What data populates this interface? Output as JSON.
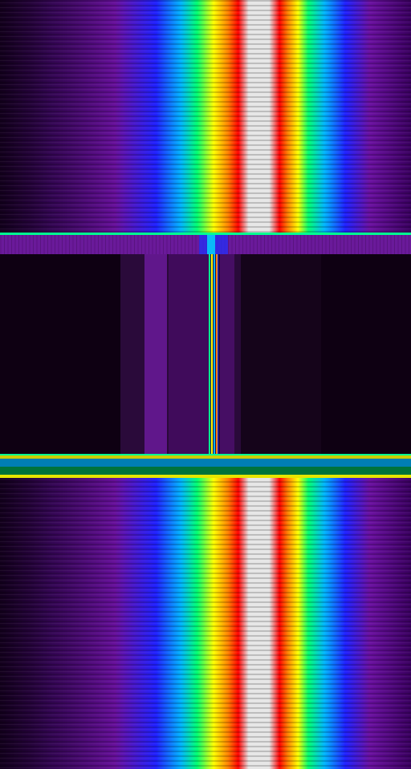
{
  "view": {
    "type": "spectrum-waterfall",
    "colormap": [
      "#000000",
      "#3a0050",
      "#7a10a8",
      "#1a1aff",
      "#00b4ff",
      "#00ff80",
      "#ffff00",
      "#ff8000",
      "#ff0000",
      "#dcdcdc"
    ],
    "segments": [
      {
        "name": "upper-signal-band",
        "kind": "signal"
      },
      {
        "name": "upper-transition",
        "kind": "transition"
      },
      {
        "name": "dead-zone",
        "kind": "quiet"
      },
      {
        "name": "lower-transition",
        "kind": "transition"
      },
      {
        "name": "lower-signal-band",
        "kind": "signal"
      }
    ]
  }
}
